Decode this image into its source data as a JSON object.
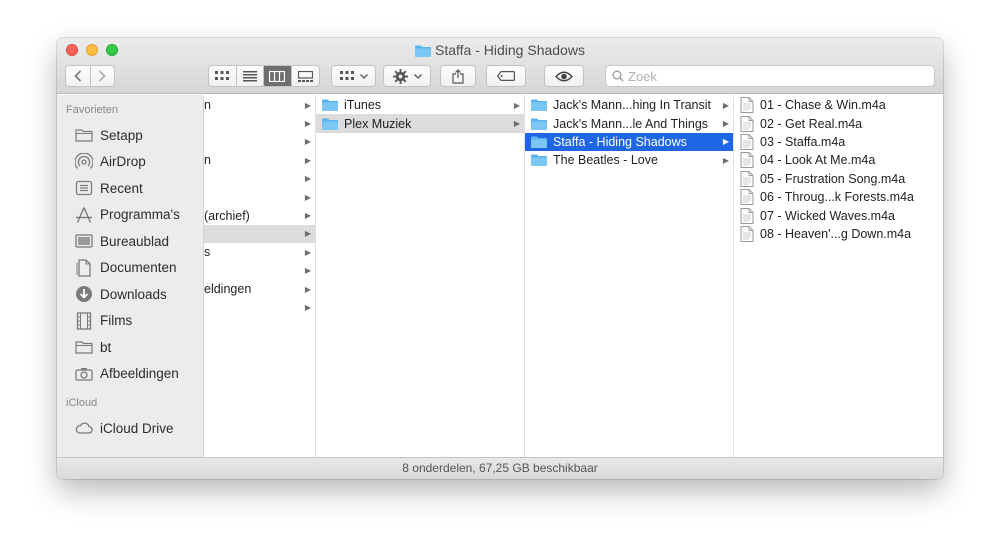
{
  "window": {
    "title": "Staffa - Hiding Shadows"
  },
  "toolbar": {
    "search_placeholder": "Zoek"
  },
  "sidebar": {
    "sections": [
      {
        "header": "Favorieten",
        "items": [
          {
            "label": "Setapp",
            "icon": "folder-icon"
          },
          {
            "label": "AirDrop",
            "icon": "airdrop-icon"
          },
          {
            "label": "Recent",
            "icon": "recent-icon"
          },
          {
            "label": "Programma's",
            "icon": "applications-icon"
          },
          {
            "label": "Bureaublad",
            "icon": "desktop-icon"
          },
          {
            "label": "Documenten",
            "icon": "documents-icon"
          },
          {
            "label": "Downloads",
            "icon": "downloads-icon"
          },
          {
            "label": "Films",
            "icon": "films-icon"
          },
          {
            "label": "bt",
            "icon": "folder-icon"
          },
          {
            "label": "Afbeeldingen",
            "icon": "camera-icon"
          }
        ]
      },
      {
        "header": "iCloud",
        "items": [
          {
            "label": "iCloud Drive",
            "icon": "cloud-icon"
          }
        ]
      }
    ]
  },
  "columns": {
    "col1": {
      "rows": [
        {
          "label": "n",
          "arrow": true
        },
        {
          "label": "",
          "arrow": true
        },
        {
          "label": "",
          "arrow": true
        },
        {
          "label": "n",
          "arrow": true
        },
        {
          "label": "",
          "arrow": true
        },
        {
          "label": "",
          "arrow": true
        },
        {
          "label": " (archief)",
          "arrow": true
        },
        {
          "label": "",
          "arrow": true,
          "state": "gray"
        },
        {
          "label": "s",
          "arrow": true
        },
        {
          "label": "",
          "arrow": true
        },
        {
          "label": "eldingen",
          "arrow": true
        },
        {
          "label": "",
          "arrow": true
        }
      ]
    },
    "col2": {
      "rows": [
        {
          "label": "iTunes",
          "arrow": true
        },
        {
          "label": "Plex Muziek",
          "arrow": true,
          "state": "gray"
        }
      ]
    },
    "col3": {
      "rows": [
        {
          "label": "Jack's Mann...hing In Transit",
          "arrow": true
        },
        {
          "label": "Jack's Mann...le And Things",
          "arrow": true
        },
        {
          "label": "Staffa - Hiding Shadows",
          "arrow": true,
          "state": "sel"
        },
        {
          "label": "The Beatles - Love",
          "arrow": true
        }
      ]
    },
    "col4": {
      "rows": [
        {
          "label": "01 - Chase & Win.m4a"
        },
        {
          "label": "02 - Get Real.m4a"
        },
        {
          "label": "03 - Staffa.m4a"
        },
        {
          "label": "04 - Look At Me.m4a"
        },
        {
          "label": "05 - Frustration Song.m4a"
        },
        {
          "label": "06 - Throug...k Forests.m4a"
        },
        {
          "label": "07 - Wicked Waves.m4a"
        },
        {
          "label": "08 - Heaven'...g Down.m4a"
        }
      ]
    }
  },
  "status": {
    "text": "8 onderdelen, 67,25 GB beschikbaar"
  },
  "colors": {
    "selection": "#1f66e5",
    "folder": "#5ab4f0",
    "close": "#fc605c",
    "minimize": "#fdbc40",
    "maximize": "#34c84a"
  }
}
